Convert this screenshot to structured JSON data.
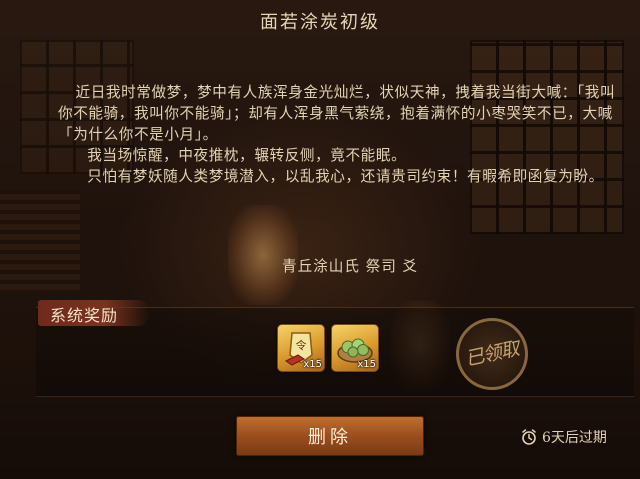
{
  "mail": {
    "title": "面若涂炭初级",
    "paragraphs": [
      "近日我时常做梦，梦中有人族浑身金光灿烂，状似天神，拽着我当街大喊：「我叫你不能骑，我叫你不能骑」；却有人浑身黑气萦绕，抱着满怀的小枣哭笑不已，大喊「为什么你不是小月」。",
      "我当场惊醒，中夜推枕，辗转反侧，竟不能眠。",
      "只怕有梦妖随人类梦境潜入，以乱我心，还请贵司约束！有暇希即函复为盼。"
    ],
    "signature": "青丘涂山氏 祭司 爻"
  },
  "rewards": {
    "label": "系统奖励",
    "items": [
      {
        "icon": "order-token-icon",
        "token_char": "令",
        "qty": "x15"
      },
      {
        "icon": "green-dumpling-basket-icon",
        "qty": "x15"
      }
    ],
    "claimed_stamp": "已领取"
  },
  "actions": {
    "delete_label": "删除",
    "expiry_text": "6天后过期"
  },
  "colors": {
    "text": "#e3d3b4",
    "button": "#9a4e1e",
    "label_ribbon": "#7b3220",
    "item_frame": "#d99a2b"
  }
}
